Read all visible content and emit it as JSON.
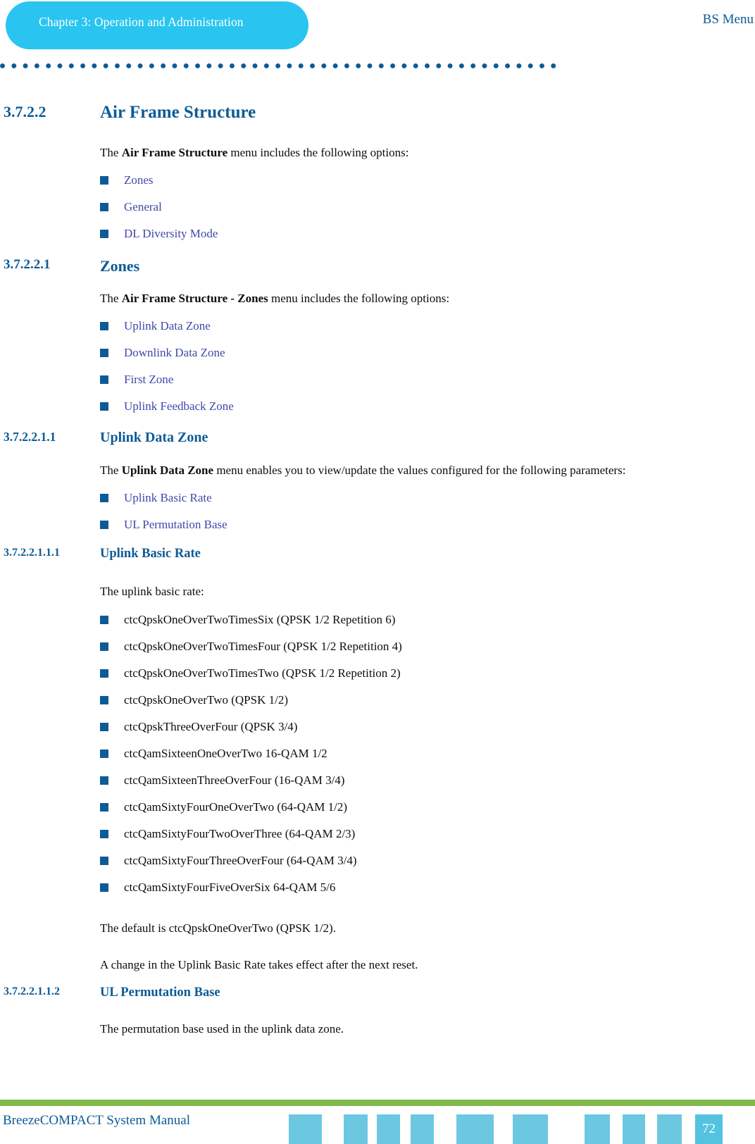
{
  "header": {
    "chapter_label": "Chapter 3: Operation and Administration",
    "running_head": "BS Menu",
    "pill_color": "#29c5f0",
    "dot_color": "#0d5b96"
  },
  "sections": [
    {
      "number": "3.7.2.2",
      "title": "Air Frame Structure",
      "intro_prefix": "The ",
      "intro_bold": "Air Frame Structure",
      "intro_suffix": " menu includes the following options:",
      "bullets": [
        "Zones",
        "General",
        "DL Diversity Mode"
      ]
    },
    {
      "number": "3.7.2.2.1",
      "title": "Zones",
      "intro_prefix": "The ",
      "intro_bold": "Air Frame Structure - Zones",
      "intro_suffix": " menu includes the following options:",
      "bullets": [
        "Uplink Data Zone",
        "Downlink Data Zone",
        "First Zone",
        "Uplink Feedback Zone"
      ]
    },
    {
      "number": "3.7.2.2.1.1",
      "title": "Uplink Data Zone",
      "intro_prefix": "The ",
      "intro_bold": "Uplink Data Zone",
      "intro_suffix": " menu enables you to view/update the values configured for the following parameters:",
      "bullets": [
        "Uplink Basic Rate",
        "UL Permutation Base"
      ]
    },
    {
      "number": "3.7.2.2.1.1.1",
      "title": "Uplink Basic Rate",
      "intro": "The uplink basic rate:",
      "rate_options": [
        "ctcQpskOneOverTwoTimesSix (QPSK 1/2 Repetition 6)",
        "ctcQpskOneOverTwoTimesFour (QPSK 1/2 Repetition 4)",
        "ctcQpskOneOverTwoTimesTwo (QPSK 1/2 Repetition 2)",
        "ctcQpskOneOverTwo (QPSK 1/2)",
        "ctcQpskThreeOverFour (QPSK 3/4)",
        "ctcQamSixteenOneOverTwo 16-QAM 1/2",
        "ctcQamSixteenThreeOverFour (16-QAM 3/4)",
        "ctcQamSixtyFourOneOverTwo (64-QAM 1/2)",
        "ctcQamSixtyFourTwoOverThree (64-QAM 2/3)",
        "ctcQamSixtyFourThreeOverFour (64-QAM 3/4)",
        "ctcQamSixtyFourFiveOverSix 64-QAM 5/6"
      ],
      "default_note": "The default is ctcQpskOneOverTwo (QPSK 1/2).",
      "reset_note": "A change in the Uplink Basic Rate takes effect after the next reset."
    },
    {
      "number": "3.7.2.2.1.1.2",
      "title": "UL Permutation Base",
      "intro": "The permutation base used in the uplink data zone."
    }
  ],
  "footer": {
    "manual_title": "BreezeCOMPACT System Manual",
    "page_number": "72",
    "rule_color": "#80b849",
    "bar_color": "#6cc8e0"
  }
}
